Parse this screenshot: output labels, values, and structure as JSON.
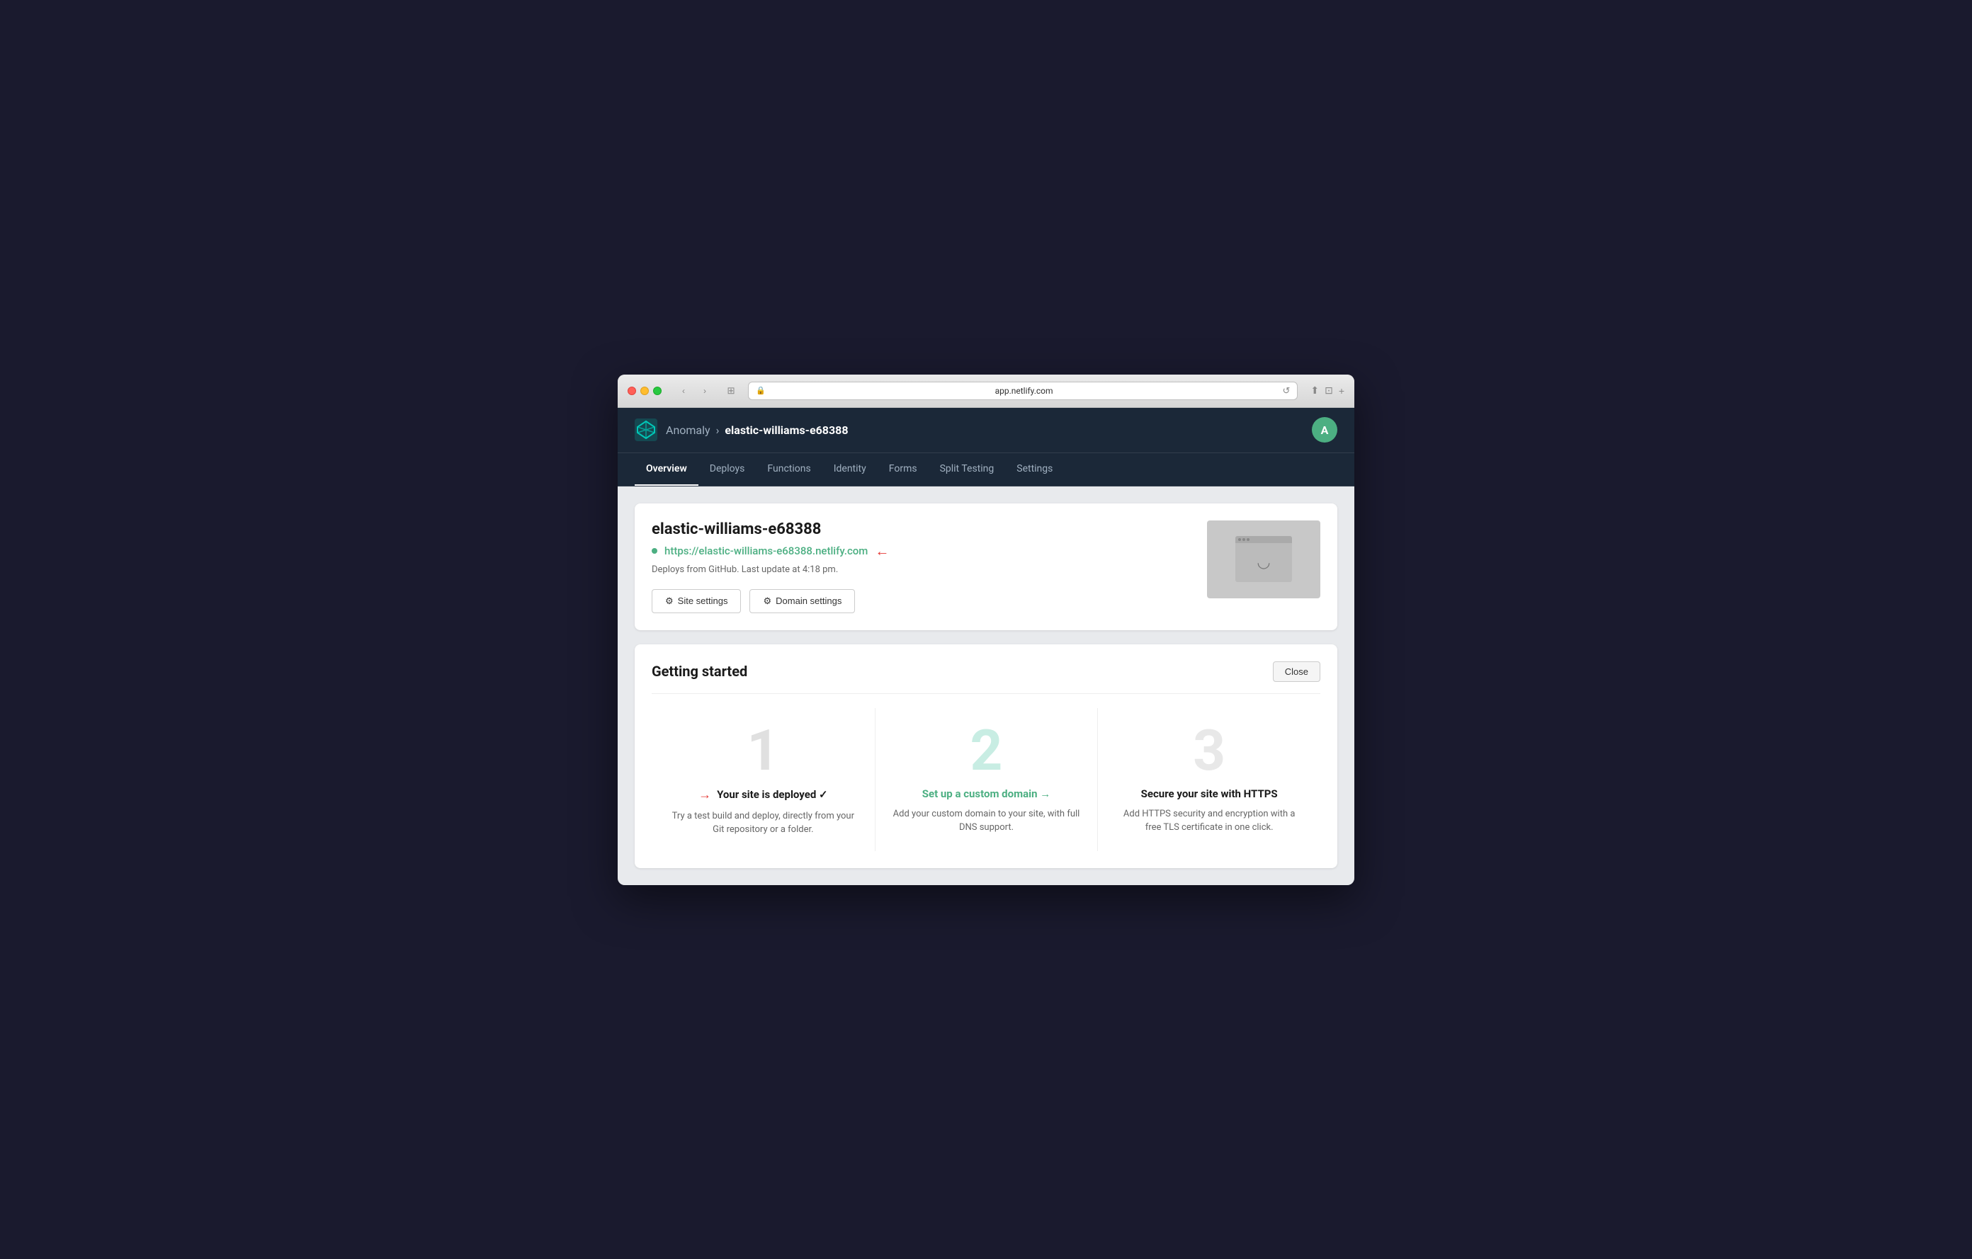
{
  "browser": {
    "address": "app.netlify.com",
    "tab_icon": "⊞"
  },
  "app": {
    "org_name": "Anomaly",
    "site_name": "elastic-williams-e68388",
    "user_initial": "A"
  },
  "nav": {
    "items": [
      {
        "label": "Overview",
        "active": true
      },
      {
        "label": "Deploys",
        "active": false
      },
      {
        "label": "Functions",
        "active": false
      },
      {
        "label": "Identity",
        "active": false
      },
      {
        "label": "Forms",
        "active": false
      },
      {
        "label": "Split Testing",
        "active": false
      },
      {
        "label": "Settings",
        "active": false
      }
    ]
  },
  "site_card": {
    "title": "elastic-williams-e68388",
    "url": "https://elastic-williams-e68388.netlify.com",
    "meta": "Deploys from GitHub. Last update at 4:18 pm.",
    "btn_site_settings": "Site settings",
    "btn_domain_settings": "Domain settings"
  },
  "getting_started": {
    "title": "Getting started",
    "close_label": "Close",
    "steps": [
      {
        "number": "1",
        "number_state": "done",
        "has_arrow": true,
        "title": "Your site is deployed ✓",
        "title_is_link": false,
        "desc": "Try a test build and deploy, directly from your Git repository or a folder."
      },
      {
        "number": "2",
        "number_state": "active",
        "has_arrow": false,
        "title": "Set up a custom domain →",
        "title_is_link": true,
        "desc": "Add your custom domain to your site, with full DNS support."
      },
      {
        "number": "3",
        "number_state": "inactive",
        "has_arrow": false,
        "title": "Secure your site with HTTPS",
        "title_is_link": false,
        "desc": "Add HTTPS security and encryption with a free TLS certificate in one click."
      }
    ]
  }
}
